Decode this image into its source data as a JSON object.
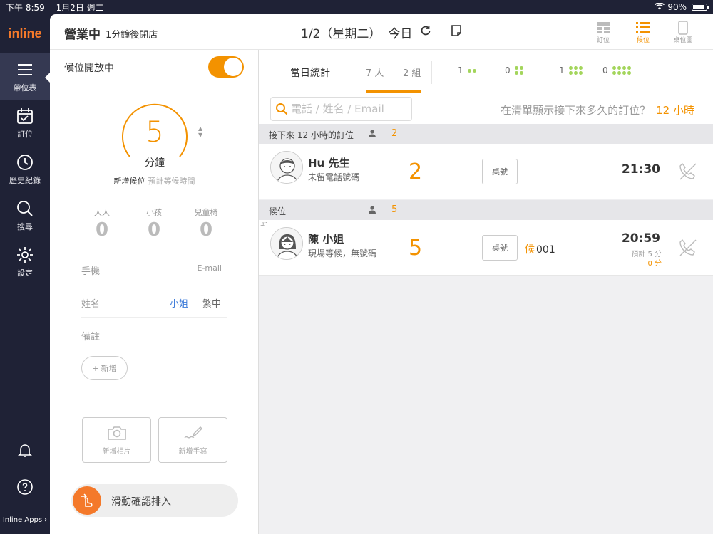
{
  "statusbar": {
    "time": "下午 8:59",
    "date": "1月2日 週二",
    "battery": "90%"
  },
  "logo": "inline",
  "nav": {
    "items": [
      {
        "label": "帶位表"
      },
      {
        "label": "訂位"
      },
      {
        "label": "歷史紀錄"
      },
      {
        "label": "搜尋"
      },
      {
        "label": "設定"
      }
    ],
    "apps_label": "Inline Apps"
  },
  "header": {
    "status": "營業中",
    "status_sub": "1分鐘後閉店",
    "date": "1/2（星期二）",
    "today": "今日",
    "view_tabs": [
      {
        "label": "訂位"
      },
      {
        "label": "候位"
      },
      {
        "label": "桌位圖"
      }
    ]
  },
  "waitlist_form": {
    "toggle_label": "候位開放中",
    "wait_minutes": "5",
    "wait_unit": "分鐘",
    "caption": "新增候位",
    "caption_hint": "預計等候時間",
    "counters": [
      {
        "label": "大人",
        "value": "0"
      },
      {
        "label": "小孩",
        "value": "0"
      },
      {
        "label": "兒童椅",
        "value": "0"
      }
    ],
    "phone_label": "手機",
    "email_label": "E-mail",
    "name_label": "姓名",
    "title_miss": "小姐",
    "title_mr": "繁中",
    "note_label": "備註",
    "add_label": "新增",
    "add_photo": "新增相片",
    "add_handwriting": "新增手寫",
    "slide_confirm": "滑動確認排入"
  },
  "stats": {
    "title": "當日統計",
    "people": "7 人",
    "groups": "2 組",
    "party_counts": [
      "1",
      "0",
      "1",
      "0"
    ]
  },
  "search": {
    "placeholder": "電話 / 姓名 / Email",
    "hours_question": "在清單顯示接下來多久的訂位？",
    "hours_value": "12 小時"
  },
  "sections": {
    "upcoming": {
      "title": "接下來 12 小時的訂位",
      "count": "2"
    },
    "waiting": {
      "title": "候位",
      "count": "5"
    }
  },
  "reservations": [
    {
      "name": "Hu 先生",
      "note": "未留電話號碼",
      "party": "2",
      "table_label": "桌號",
      "time": "21:30"
    }
  ],
  "waitlist": [
    {
      "index": "#1",
      "name": "陳 小姐",
      "note": "現場等候，無號碼",
      "party": "5",
      "table_label": "桌號",
      "queue_prefix": "候",
      "queue_no": "001",
      "time": "20:59",
      "estimate": "預計 5 分",
      "elapsed": "0 分"
    }
  ],
  "colors": {
    "accent": "#f39200",
    "nav_bg": "#1f2236",
    "dot": "#a3d55b"
  }
}
